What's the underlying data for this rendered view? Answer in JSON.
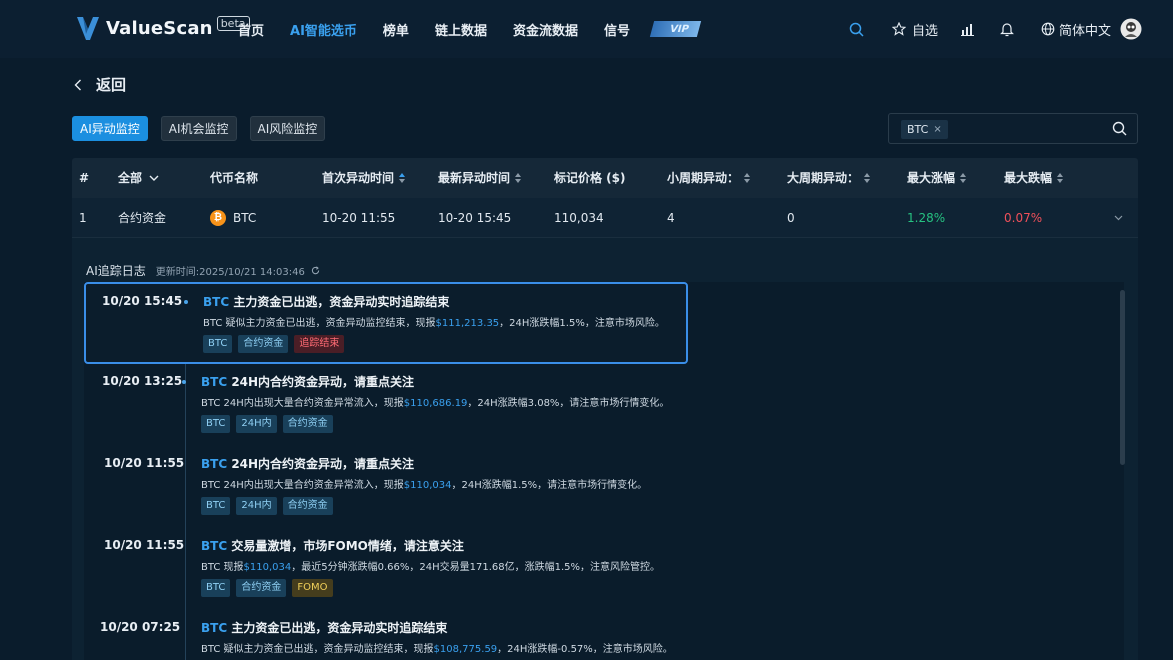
{
  "nav": {
    "brand": "ValueScan",
    "beta": "beta",
    "menu": [
      "首页",
      "AI智能选币",
      "榜单",
      "链上数据",
      "资金流数据",
      "信号"
    ],
    "active_index": 1,
    "vip": "VIP",
    "favorites": "自选",
    "language": "简体中文"
  },
  "back": "返回",
  "tabs": [
    "AI异动监控",
    "AI机会监控",
    "AI风险监控"
  ],
  "search": {
    "chip": "BTC",
    "chip_close": "×"
  },
  "table": {
    "headers": [
      "#",
      "全部",
      "代币名称",
      "首次异动时间",
      "最新异动时间",
      "标记价格 ($)",
      "小周期异动：",
      "大周期异动：",
      "最大涨幅",
      "最大跌幅"
    ],
    "row": {
      "index": "1",
      "category": "合约资金",
      "coin": "BTC",
      "first_time": "10-20 11:55",
      "last_time": "10-20 15:45",
      "price": "110,034",
      "small_cycle": "4",
      "large_cycle": "0",
      "max_rise": "1.28%",
      "max_drop": "0.07%"
    }
  },
  "log": {
    "title": "AI追踪日志",
    "updated": "更新时间:2025/10/21 14:03:46",
    "entries": [
      {
        "time": "10/20 15:45",
        "coin": "BTC",
        "title": " 主力资金已出逃，资金异动实时追踪结束",
        "desc_a": "BTC 疑似主力资金已出逃，资金异动监控结束，现报",
        "price": "$111,213.35",
        "desc_b": "，24H涨跌幅1.5%，注意市场风险。",
        "tags": [
          "BTC",
          "合约资金",
          "追踪结束"
        ]
      },
      {
        "time": "10/20 13:25",
        "coin": "BTC",
        "title": " 24H内合约资金异动，请重点关注",
        "desc_a": "BTC 24H内出现大量合约资金异常流入，现报",
        "price": "$110,686.19",
        "desc_b": "，24H涨跌幅3.08%，请注意市场行情变化。",
        "tags": [
          "BTC",
          "24H内",
          "合约资金"
        ]
      },
      {
        "time": "10/20 11:55",
        "coin": "BTC",
        "title": " 24H内合约资金异动，请重点关注",
        "desc_a": "BTC 24H内出现大量合约资金异常流入，现报",
        "price": "$110,034",
        "desc_b": "，24H涨跌幅1.5%，请注意市场行情变化。",
        "tags": [
          "BTC",
          "24H内",
          "合约资金"
        ]
      },
      {
        "time": "10/20 11:55",
        "coin": "BTC",
        "title": " 交易量激增，市场FOMO情绪，请注意关注",
        "desc_a": "BTC 现报",
        "price": "$110,034",
        "desc_b": "，最近5分钟涨跌幅0.66%，24H交易量171.68亿，涨跌幅1.5%，注意风险管控。",
        "tags": [
          "BTC",
          "合约资金",
          "FOMO"
        ]
      },
      {
        "time": "10/20 07:25",
        "coin": "BTC",
        "title": " 主力资金已出逃，资金异动实时追踪结束",
        "desc_a": "BTC 疑似主力资金已出逃，资金异动监控结束，现报",
        "price": "$108,775.59",
        "desc_b": "，24H涨跌幅-0.57%，注意市场风险。",
        "tags": []
      }
    ]
  }
}
